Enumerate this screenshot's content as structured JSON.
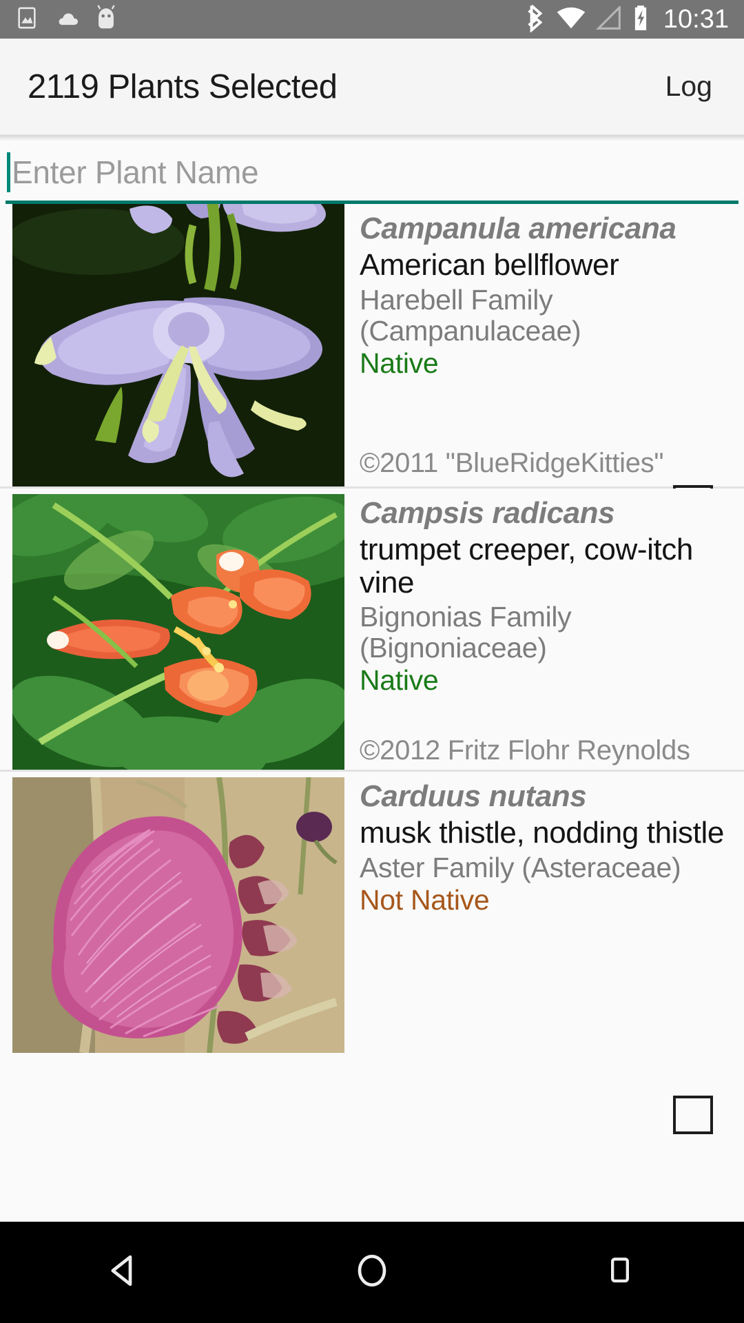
{
  "status_bar": {
    "icons_left": [
      "image-icon",
      "cloud-icon",
      "android-icon"
    ],
    "icons_right": [
      "bluetooth-icon",
      "wifi-icon",
      "cell-signal-icon",
      "battery-charging-icon"
    ],
    "time": "10:31",
    "background": "#757575"
  },
  "app_bar": {
    "title": "2119 Plants Selected",
    "action_label": "Log"
  },
  "search": {
    "placeholder": "Enter Plant Name",
    "value": "",
    "accent_color": "#00796b",
    "caret_color": "#00897b"
  },
  "colors": {
    "native": "#1a7a18",
    "not_native": "#a6571b",
    "scientific_name": "#7c7c7c",
    "common_name": "#141414",
    "secondary_text": "#7c7c7c",
    "credit_text": "#8a8a8a",
    "list_background": "#fafafa",
    "appbar_background": "#f5f5f5"
  },
  "list": {
    "items": [
      {
        "scientific_name": "Campanula americana",
        "common_name": "American bellflower",
        "family": "Harebell Family (Campanulaceae)",
        "nativity": "Native",
        "nativity_state": "native",
        "credit": "©2011 \"BlueRidgeKitties\"",
        "checkbox_checked": false,
        "clipped_top": true
      },
      {
        "scientific_name": "Campsis radicans",
        "common_name": "trumpet creeper, cow-itch vine",
        "family": "Bignonias Family (Bignoniaceae)",
        "nativity": "Native",
        "nativity_state": "native",
        "credit": "©2012 Fritz Flohr Reynolds",
        "checkbox_checked": false,
        "clipped_top": false
      },
      {
        "scientific_name": "Carduus nutans",
        "common_name": "musk thistle, nodding thistle",
        "family": "Aster Family (Asteraceae)",
        "nativity": "Not Native",
        "nativity_state": "not_native",
        "credit": "",
        "checkbox_checked": false,
        "clipped_bottom": true
      }
    ]
  },
  "nav_bar": {
    "buttons": [
      {
        "name": "back-icon",
        "label": "Back"
      },
      {
        "name": "home-icon",
        "label": "Home"
      },
      {
        "name": "recents-icon",
        "label": "Recents"
      }
    ]
  }
}
